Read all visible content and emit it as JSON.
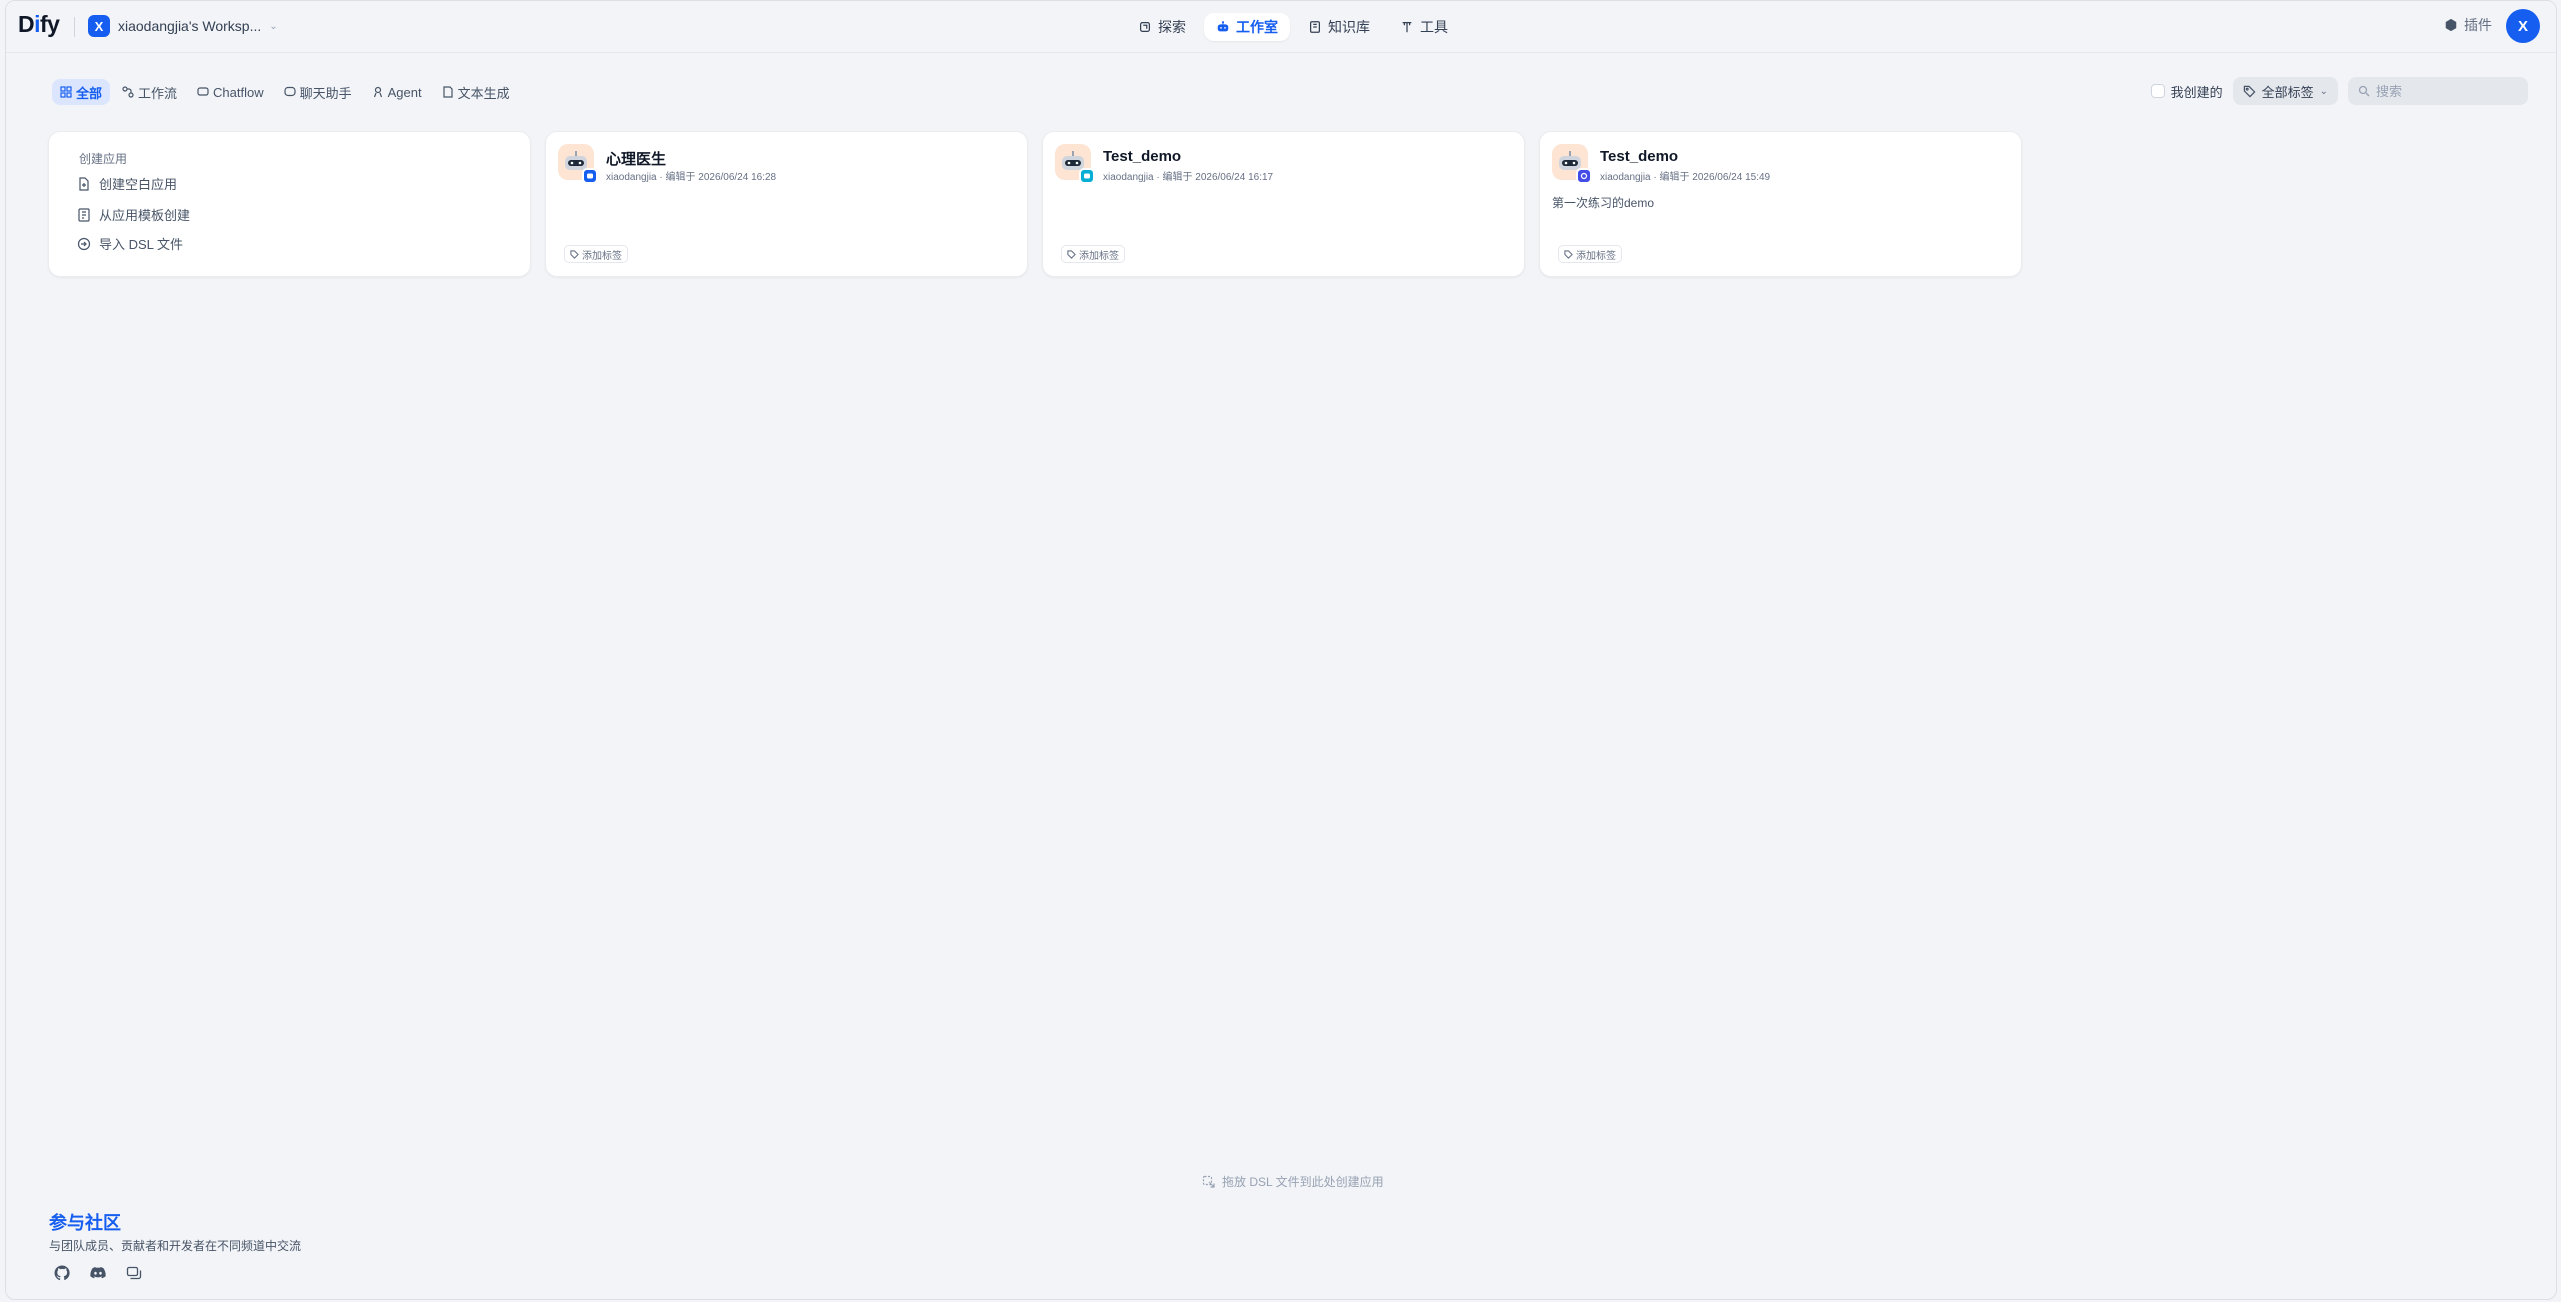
{
  "header": {
    "logo_main": "D",
    "logo_i": "i",
    "logo_rest": "fy",
    "workspace_initial": "X",
    "workspace_name": "xiaodangjia's Worksp...",
    "nav": [
      {
        "label": "探索",
        "icon": "explore-icon"
      },
      {
        "label": "工作室",
        "icon": "robot-icon",
        "active": true
      },
      {
        "label": "知识库",
        "icon": "book-icon"
      },
      {
        "label": "工具",
        "icon": "tool-icon"
      }
    ],
    "plugins_label": "插件",
    "user_initial": "X"
  },
  "tabs": [
    {
      "label": "全部",
      "active": true
    },
    {
      "label": "工作流"
    },
    {
      "label": "Chatflow"
    },
    {
      "label": "聊天助手"
    },
    {
      "label": "Agent"
    },
    {
      "label": "文本生成"
    }
  ],
  "filters": {
    "mine_label": "我创建的",
    "tags_label": "全部标签",
    "search_placeholder": "搜索"
  },
  "create": {
    "title": "创建应用",
    "blank": "创建空白应用",
    "template": "从应用模板创建",
    "import": "导入 DSL 文件"
  },
  "apps": [
    {
      "name": "心理医生",
      "meta": "xiaodangjia · 编辑于 2026/06/24 16:28",
      "desc": "",
      "tag_label": "添加标签",
      "badge_color": "#155eef"
    },
    {
      "name": "Test_demo",
      "meta": "xiaodangjia · 编辑于 2026/06/24 16:17",
      "desc": "",
      "tag_label": "添加标签",
      "badge_color": "#06aed4"
    },
    {
      "name": "Test_demo",
      "meta": "xiaodangjia · 编辑于 2026/06/24 15:49",
      "desc": "第一次练习的demo",
      "tag_label": "添加标签",
      "badge_color": "#444ce7"
    }
  ],
  "footer": {
    "dsl_hint": "拖放 DSL 文件到此处创建应用",
    "community_title": "参与社区",
    "community_desc": "与团队成员、贡献者和开发者在不同频道中交流"
  },
  "colors": {
    "accent": "#155eef",
    "background": "#f2f4f7"
  }
}
